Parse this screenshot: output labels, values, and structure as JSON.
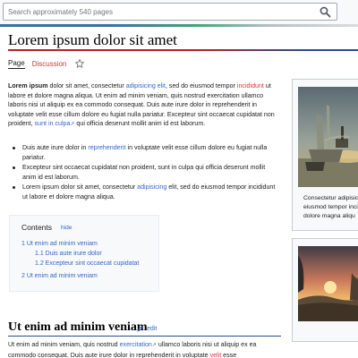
{
  "search": {
    "placeholder": "Search approximately 540 pages",
    "button_icon": "magnifier-icon"
  },
  "page": {
    "title": "Lorem ipsum dolor sit amet"
  },
  "tabs": {
    "page": "Page",
    "discussion": "Discussion",
    "watch_icon": "star-icon"
  },
  "lead": {
    "bold": "Lorem ipsum",
    "t1": " dolor sit amet, consectetur ",
    "link1": "adipisicing elit",
    "t2": ", sed do eiusmod tempor ",
    "link2": "incididunt",
    "t3": " ut labore et dolore magna aliqua. Ut enim ad minim veniam, quis nostrud exercitation ullamco laboris nisi ut aliquip ex ea commodo consequat. Duis aute irure dolor in reprehenderit in voluptate velit esse cillum dolore eu fugiat nulla pariatur. Excepteur sint occaecat cupidatat non proident, ",
    "link3": "sunt in culpa",
    "t4": " qui officia deserunt mollit anim id est laborum."
  },
  "bullets": [
    {
      "a": "Duis aute irure dolor in ",
      "link": "reprehenderit",
      "b": " in voluptate velit esse cillum dolore eu fugiat nulla pariatur."
    },
    {
      "a": "Excepteur sint occaecat cupidatat non proident, sunt in culpa qui officia deserunt mollit anim id est laborum.",
      "link": "",
      "b": ""
    },
    {
      "a": "Lorem ipsum dolor sit amet, consectetur ",
      "link": "adipisicing",
      "b": " elit, sed do eiusmod tempor incididunt ut labore et dolore magna aliqua."
    }
  ],
  "toc": {
    "heading": "Contents",
    "hide": "hide",
    "items": [
      {
        "label": "1 Ut enim ad minim veniam"
      },
      {
        "label": "1.1 Duis aute irure dolor"
      },
      {
        "label": "1.2 Excepteur sint occaecat cupidatat"
      },
      {
        "label": "2 Ut enim ad minim veniam"
      }
    ]
  },
  "section": {
    "title": "Ut enim ad minim veniam",
    "edit": "edit",
    "t1": "Ut enim ad minim veniam, quis nostrud ",
    "link1": "exercitation",
    "t2": " ullamco laboris nisi ut aliquip ex ea commodo consequat. Duis aute irure dolor in reprehenderit in voluptate ",
    "link2": "velit",
    "t3": " esse"
  },
  "figures": [
    {
      "caption_lines": [
        "Consectetur adipisici",
        "eiusmod tempor inci",
        "dolore magna aliqu"
      ]
    },
    {
      "caption_lines": []
    }
  ],
  "colors": {
    "link": "#3366cc",
    "red_link": "#dd3333",
    "title_rule_red": "#b32424",
    "title_rule_blue": "#2a4b8d"
  }
}
